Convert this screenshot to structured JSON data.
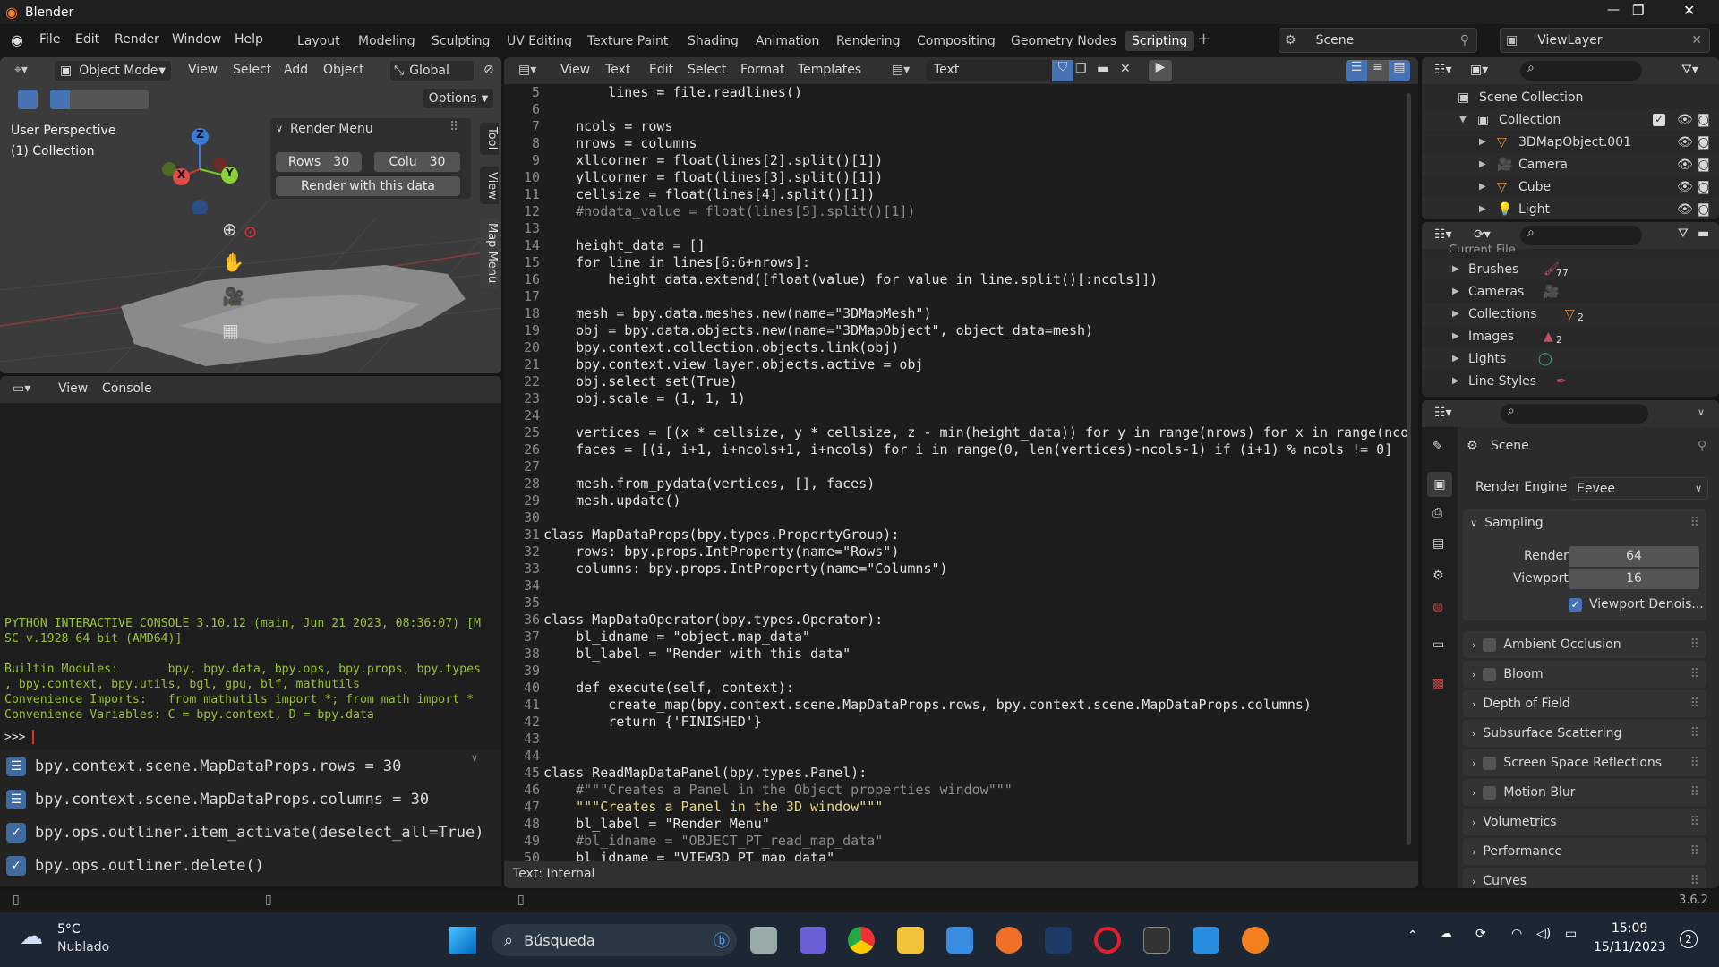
{
  "window": {
    "title": "Blender"
  },
  "menu": [
    "File",
    "Edit",
    "Render",
    "Window",
    "Help"
  ],
  "workspaces": [
    "Layout",
    "Modeling",
    "Sculpting",
    "UV Editing",
    "Texture Paint",
    "Shading",
    "Animation",
    "Rendering",
    "Compositing",
    "Geometry Nodes",
    "Scripting"
  ],
  "active_workspace": "Scripting",
  "scene": "Scene",
  "view_layer": "ViewLayer",
  "viewport": {
    "mode": "Object Mode",
    "menus": [
      "View",
      "Select",
      "Add",
      "Object"
    ],
    "orientation": "Global",
    "options": "Options",
    "perspective": "User Perspective",
    "collection": "(1) Collection",
    "gizmo": {
      "x": "X",
      "y": "Y",
      "z": "Z"
    },
    "tabs": [
      "Tool",
      "View",
      "Map Menu"
    ],
    "render_menu": {
      "title": "Render Menu",
      "rows_label": "Rows",
      "rows_value": "30",
      "cols_label": "Colu",
      "cols_value": "30",
      "button": "Render with this data"
    }
  },
  "console": {
    "menus": [
      "View",
      "Console"
    ],
    "output": [
      "PYTHON INTERACTIVE CONSOLE 3.10.12 (main, Jun 21 2023, 08:36:07) [M",
      "SC v.1928 64 bit (AMD64)]",
      "",
      "Builtin Modules:       bpy, bpy.data, bpy.ops, bpy.props, bpy.types",
      ", bpy.context, bpy.utils, bgl, gpu, blf, mathutils",
      "Convenience Imports:   from mathutils import *; from math import *",
      "Convenience Variables: C = bpy.context, D = bpy.data"
    ],
    "prompt": ">>> ",
    "history": [
      {
        "text": "bpy.context.scene.MapDataProps.rows = 30",
        "icon": "sliders-icon"
      },
      {
        "text": "bpy.context.scene.MapDataProps.columns = 30",
        "icon": "sliders-icon"
      },
      {
        "text": "bpy.ops.outliner.item_activate(deselect_all=True)",
        "icon": "check-icon"
      },
      {
        "text": "bpy.ops.outliner.delete()",
        "icon": "check-icon"
      }
    ]
  },
  "text_editor": {
    "menus": [
      "View",
      "Text",
      "Edit",
      "Select",
      "Format",
      "Templates"
    ],
    "datablock": "Text",
    "footer": "Text: Internal",
    "first_line": 5,
    "lines": [
      "        lines = file.readlines()",
      "",
      "    ncols = rows",
      "    nrows = columns",
      "    xllcorner = float(lines[2].split()[1])",
      "    yllcorner = float(lines[3].split()[1])",
      "    cellsize = float(lines[4].split()[1])",
      "    #nodata_value = float(lines[5].split()[1])",
      "",
      "    height_data = []",
      "    for line in lines[6:6+nrows]:",
      "        height_data.extend([float(value) for value in line.split()[:ncols]])",
      "",
      "    mesh = bpy.data.meshes.new(name=\"3DMapMesh\")",
      "    obj = bpy.data.objects.new(name=\"3DMapObject\", object_data=mesh)",
      "    bpy.context.collection.objects.link(obj)",
      "    bpy.context.view_layer.objects.active = obj",
      "    obj.select_set(True)",
      "    obj.scale = (1, 1, 1)",
      "",
      "    vertices = [(x * cellsize, y * cellsize, z - min(height_data)) for y in range(nrows) for x in range(nco",
      "    faces = [(i, i+1, i+ncols+1, i+ncols) for i in range(0, len(vertices)-ncols-1) if (i+1) % ncols != 0]",
      "",
      "    mesh.from_pydata(vertices, [], faces)",
      "    mesh.update()",
      "",
      "class MapDataProps(bpy.types.PropertyGroup):",
      "    rows: bpy.props.IntProperty(name=\"Rows\")",
      "    columns: bpy.props.IntProperty(name=\"Columns\")",
      "",
      "",
      "class MapDataOperator(bpy.types.Operator):",
      "    bl_idname = \"object.map_data\"",
      "    bl_label = \"Render with this data\"",
      "",
      "    def execute(self, context):",
      "        create_map(bpy.context.scene.MapDataProps.rows, bpy.context.scene.MapDataProps.columns)",
      "        return {'FINISHED'}",
      "",
      "",
      "class ReadMapDataPanel(bpy.types.Panel):",
      "    #\"\"\"Creates a Panel in the Object properties window\"\"\"",
      "    \"\"\"Creates a Panel in the 3D window\"\"\"",
      "    bl_label = \"Render Menu\"",
      "    #bl_idname = \"OBJECT_PT_read_map_data\"",
      "    bl_idname = \"VIEW3D_PT_map_data\""
    ]
  },
  "outliner": {
    "items": [
      {
        "label": "Scene Collection",
        "depth": 0
      },
      {
        "label": "Collection",
        "depth": 1
      },
      {
        "label": "3DMapObject.001",
        "depth": 2,
        "icon": "mesh-icon"
      },
      {
        "label": "Camera",
        "depth": 2,
        "icon": "camera-icon"
      },
      {
        "label": "Cube",
        "depth": 2,
        "icon": "mesh-icon"
      },
      {
        "label": "Light",
        "depth": 2,
        "icon": "light-icon"
      }
    ]
  },
  "blender_file": {
    "root": "Current File",
    "items": [
      {
        "label": "Brushes",
        "count": "77"
      },
      {
        "label": "Cameras",
        "count": ""
      },
      {
        "label": "Collections",
        "count": "2"
      },
      {
        "label": "Images",
        "count": "2"
      },
      {
        "label": "Lights",
        "count": ""
      },
      {
        "label": "Line Styles",
        "count": ""
      }
    ]
  },
  "properties": {
    "title": "Scene",
    "render_engine_label": "Render Engine",
    "render_engine": "Eevee",
    "sampling": "Sampling",
    "render_label": "Render",
    "render_value": "64",
    "viewport_label": "Viewport",
    "viewport_value": "16",
    "denoise": "Viewport Denois...",
    "panels": [
      {
        "label": "Ambient Occlusion",
        "checkbox": true
      },
      {
        "label": "Bloom",
        "checkbox": true
      },
      {
        "label": "Depth of Field",
        "checkbox": false
      },
      {
        "label": "Subsurface Scattering",
        "checkbox": false
      },
      {
        "label": "Screen Space Reflections",
        "checkbox": true
      },
      {
        "label": "Motion Blur",
        "checkbox": true
      },
      {
        "label": "Volumetrics",
        "checkbox": false
      },
      {
        "label": "Performance",
        "checkbox": false
      },
      {
        "label": "Curves",
        "checkbox": false
      }
    ]
  },
  "statusbar": {
    "version": "3.6.2"
  },
  "taskbar": {
    "temp": "5°C",
    "weather": "Nublado",
    "search": "Búsqueda",
    "time": "15:09",
    "date": "15/11/2023",
    "notifications": "2"
  },
  "colors": {
    "accent": "#4772b3",
    "console_text": "#97c233",
    "keyword": "#ec8a45",
    "string": "#e4d48a",
    "number": "#3cb8e3"
  }
}
